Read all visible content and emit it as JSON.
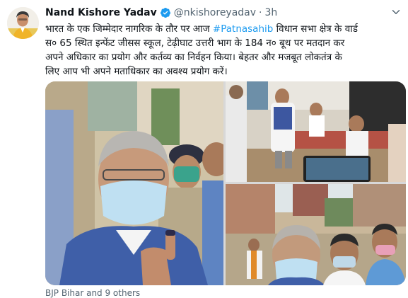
{
  "tweet": {
    "author_name": "Nand Kishore Yadav",
    "handle": "@nkishoreyadav",
    "separator": "·",
    "time": "3h",
    "text_lines": [
      {
        "before": "भारत के एक जिम्मेदार नागरिक के तौर पर आज ",
        "hashtag": "#Patnasahib",
        "after": " विधान सभा क्षेत्र के वार्ड"
      },
      {
        "before": "स० 65 स्थित इन्फेंट जीसस स्कूल, टेढ़ीघाट उत्तरी भाग के 184 न० बूथ पर मतदान कर",
        "hashtag": "",
        "after": ""
      },
      {
        "before": "अपने अधिकार का प्रयोग और कर्तव्य का निर्वहन किया। बेहतर और मजबूत लोकतंत्र के",
        "hashtag": "",
        "after": ""
      },
      {
        "before": "लिए आप भी अपने मताधिकार का अवश्य प्रयोग करें।",
        "hashtag": "",
        "after": ""
      }
    ],
    "footer": "BJP Bihar and 9 others"
  },
  "icons": {
    "verified": "verified-badge-icon",
    "more": "chevron-down-icon"
  },
  "colors": {
    "link": "#1d9bf0",
    "secondary_text": "#536471",
    "verified": "#1d9bf0"
  }
}
